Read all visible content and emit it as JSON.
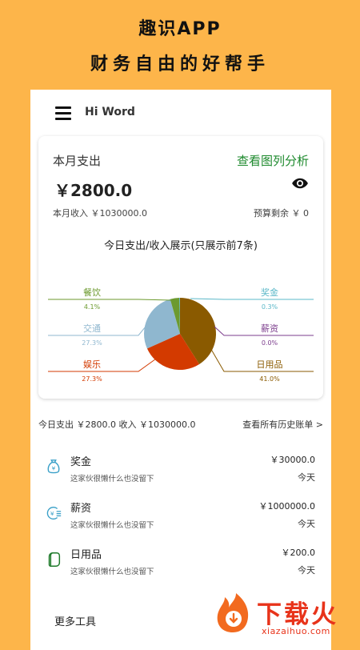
{
  "promo": {
    "line1": "趣识APP",
    "line2": "财务自由的好帮手"
  },
  "header": {
    "title": "Hi Word",
    "menu_icon": "hamburger-menu-icon"
  },
  "card": {
    "title": "本月支出",
    "link": "查看图列分析",
    "amount": "￥2800.0",
    "visibility_icon": "eye-icon",
    "income": "本月收入 ￥1030000.0",
    "budget": "预算剩余 ￥ 0"
  },
  "chart_data": {
    "type": "pie",
    "title": "今日支出/收入展示(只展示前7条)",
    "slices": [
      {
        "label": "日用品",
        "percent_label": "41.0%",
        "value": 41.0,
        "color": "#8A5A00"
      },
      {
        "label": "娱乐",
        "percent_label": "27.3%",
        "value": 27.3,
        "color": "#D33A00"
      },
      {
        "label": "交通",
        "percent_label": "27.3%",
        "value": 27.3,
        "color": "#8FB7CF"
      },
      {
        "label": "餐饮",
        "percent_label": "4.1%",
        "value": 4.1,
        "color": "#6C9A2E"
      },
      {
        "label": "奖金",
        "percent_label": "0.3%",
        "value": 0.3,
        "color": "#5BB8C8"
      },
      {
        "label": "薪资",
        "percent_label": "0.0%",
        "value": 0.0,
        "color": "#7B3C8C"
      }
    ]
  },
  "summary": {
    "text": "今日支出 ￥2800.0  收入 ￥1030000.0",
    "link": "查看所有历史账单  >"
  },
  "transactions": [
    {
      "name": "奖金",
      "desc": "这家伙很懒什么也没留下",
      "amount": "￥30000.0",
      "date": "今天",
      "icon": "money-bag-icon"
    },
    {
      "name": "薪资",
      "desc": "这家伙很懒什么也没留下",
      "amount": "￥1000000.0",
      "date": "今天",
      "icon": "salary-icon"
    },
    {
      "name": "日用品",
      "desc": "这家伙很懒什么也没留下",
      "amount": "￥200.0",
      "date": "今天",
      "icon": "tissue-icon"
    }
  ],
  "more_tools": "更多工具",
  "watermark": {
    "text": "下载火",
    "url": "xiazaihuo.com"
  },
  "colors": {
    "background": "#FDB54A",
    "link_green": "#1E8A2E",
    "icon_blue": "#3AA0C8",
    "watermark_red": "#E8331A"
  }
}
